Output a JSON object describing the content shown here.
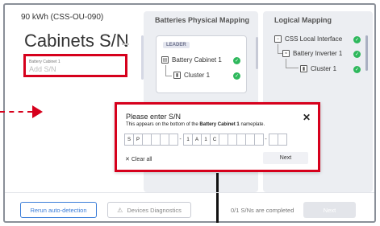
{
  "header": {
    "capacity": "90 kWh (CSS-OU-090)",
    "title": "Cabinets S/N"
  },
  "sn_field": {
    "label": "Battery Cabinet 1",
    "placeholder": "Add S/N"
  },
  "physical": {
    "title": "Batteries Physical Mapping",
    "badge": "LEADER",
    "items": [
      {
        "label": "Battery Cabinet 1"
      },
      {
        "label": "Cluster 1"
      }
    ]
  },
  "logical": {
    "title": "Logical Mapping",
    "items": [
      {
        "label": "CSS Local Interface"
      },
      {
        "label": "Battery Inverter 1"
      },
      {
        "label": "Cluster 1"
      }
    ]
  },
  "modal": {
    "title": "Please enter S/N",
    "desc_pre": "This appears on the bottom of the",
    "desc_bold": "Battery Cabinet 1",
    "desc_post": "nameplate.",
    "groups": [
      [
        "S",
        "P",
        "",
        "",
        "",
        ""
      ],
      [
        "1",
        "A",
        "1",
        "C",
        "",
        "",
        "",
        "",
        ""
      ],
      [
        "",
        ""
      ]
    ],
    "clear_label": "Clear all",
    "next_label": "Next",
    "close_icon": "close-icon"
  },
  "footer": {
    "rerun_label": "Rerun auto-detection",
    "diag_label": "Devices Diagnostics",
    "status": "0/1 S/Ns are completed",
    "next_label": "Next"
  },
  "colors": {
    "highlight": "#d6001c",
    "accent": "#3b7dd8",
    "success": "#2eb85c"
  }
}
